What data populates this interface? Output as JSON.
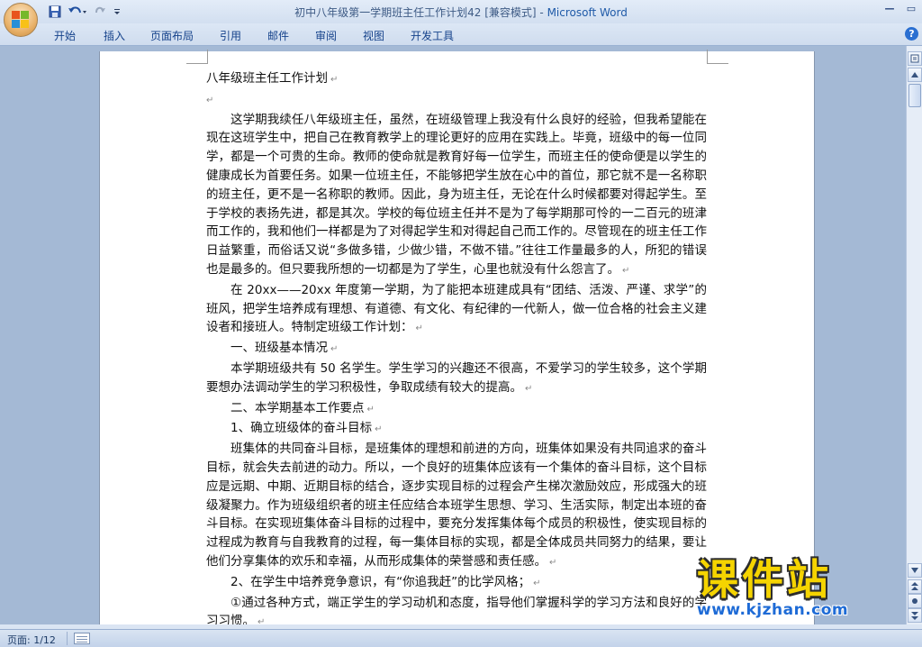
{
  "window": {
    "title": "初中八年级第一学期班主任工作计划42 [兼容模式] - ",
    "app_name": "Microsoft Word",
    "controls": {
      "minimize": "—",
      "maximize": "▭"
    }
  },
  "ribbon": {
    "tabs": [
      "开始",
      "插入",
      "页面布局",
      "引用",
      "邮件",
      "审阅",
      "视图",
      "开发工具"
    ],
    "help": "?"
  },
  "document": {
    "title": "八年级班主任工作计划",
    "paragraphs": [
      "这学期我续任八年级班主任，虽然，在班级管理上我没有什么良好的经验，但我希望能在现在这班学生中，把自己在教育教学上的理论更好的应用在实践上。毕竟，班级中的每一位同学，都是一个可贵的生命。教师的使命就是教育好每一位学生，而班主任的使命便是以学生的健康成长为首要任务。如果一位班主任，不能够把学生放在心中的首位，那它就不是一名称职的班主任，更不是一名称职的教师。因此，身为班主任，无论在什么时候都要对得起学生。至于学校的表扬先进，都是其次。学校的每位班主任并不是为了每学期那可怜的一二百元的班津而工作的，我和他们一样都是为了对得起学生和对得起自己而工作的。尽管现在的班主任工作日益繁重，而俗话又说“多做多错，少做少错，不做不错。”往往工作量最多的人，所犯的错误也是最多的。但只要我所想的一切都是为了学生，心里也就没有什么怨言了。",
      "在 20xx——20xx 年度第一学期，为了能把本班建成具有“团结、活泼、严谨、求学”的班风，把学生培养成有理想、有道德、有文化、有纪律的一代新人，做一位合格的社会主义建设者和接班人。特制定班级工作计划：",
      "一、班级基本情况",
      "本学期班级共有 50 名学生。学生学习的兴趣还不很高，不爱学习的学生较多，这个学期要想办法调动学生的学习积极性，争取成绩有较大的提高。",
      "二、本学期基本工作要点",
      "1、确立班级体的奋斗目标",
      "班集体的共同奋斗目标，是班集体的理想和前进的方向，班集体如果没有共同追求的奋斗目标，就会失去前进的动力。所以，一个良好的班集体应该有一个集体的奋斗目标，这个目标应是远期、中期、近期目标的结合，逐步实现目标的过程会产生梯次激励效应，形成强大的班级凝聚力。作为班级组织者的班主任应结合本班学生思想、学习、生活实际，制定出本班的奋斗目标。在实现班集体奋斗目标的过程中，要充分发挥集体每个成员的积极性，使实现目标的过程成为教育与自我教育的过程，每一集体目标的实现，都是全体成员共同努力的结果，要让他们分享集体的欢乐和幸福，从而形成集体的荣誉感和责任感。",
      "2、在学生中培养竞争意识，有“你追我赶”的比学风格；",
      "①通过各种方式，端正学生的学习动机和态度，指导他们掌握科学的学习方法和良好的学习习惯。"
    ],
    "paragraph_mark": "↵"
  },
  "watermark": {
    "text": "课件站",
    "url": "www.kjzhan.com"
  },
  "statusbar": {
    "page": "页面: 1/12"
  },
  "colors": {
    "ribbon_text": "#15428b",
    "app_name": "#1f5aa8",
    "doc_bg": "#a4b9d5"
  }
}
